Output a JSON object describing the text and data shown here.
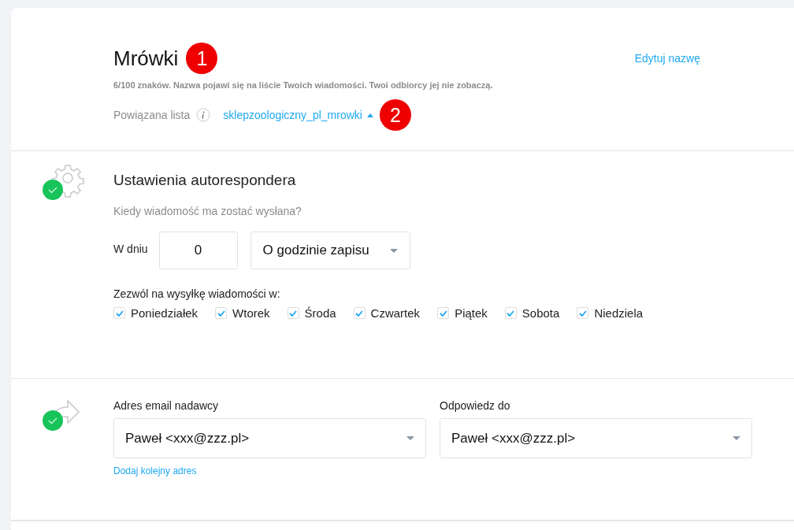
{
  "header": {
    "title": "Mrówki",
    "title_callout": "1",
    "hint": "6/100 znaków. Nazwa pojawi się na liście Twoich wiadomości. Twoi odbiorcy jej nie zobaczą.",
    "edit_link": "Edytuj nazwę",
    "list_label": "Powiązana lista",
    "list_value": "sklepzoologiczny_pl_mrowki",
    "list_callout": "2"
  },
  "settings": {
    "done": true,
    "title": "Ustawienia autorespondera",
    "question": "Kiedy wiadomość ma zostać wysłana?",
    "day_label": "W dniu",
    "day_value": "0",
    "time_value": "O godzinie zapisu",
    "days_label": "Zezwól na wysyłkę wiadomości w:",
    "days": [
      {
        "label": "Poniedziałek",
        "checked": true
      },
      {
        "label": "Wtorek",
        "checked": true
      },
      {
        "label": "Środa",
        "checked": true
      },
      {
        "label": "Czwartek",
        "checked": true
      },
      {
        "label": "Piątek",
        "checked": true
      },
      {
        "label": "Sobota",
        "checked": true
      },
      {
        "label": "Niedziela",
        "checked": true
      }
    ]
  },
  "sender": {
    "done": true,
    "from_label": "Adres email nadawcy",
    "from_value": "Paweł <xxx@zzz.pl>",
    "add_link": "Dodaj kolejny adres",
    "reply_label": "Odpowiedz do",
    "reply_value": "Paweł <xxx@zzz.pl>"
  }
}
